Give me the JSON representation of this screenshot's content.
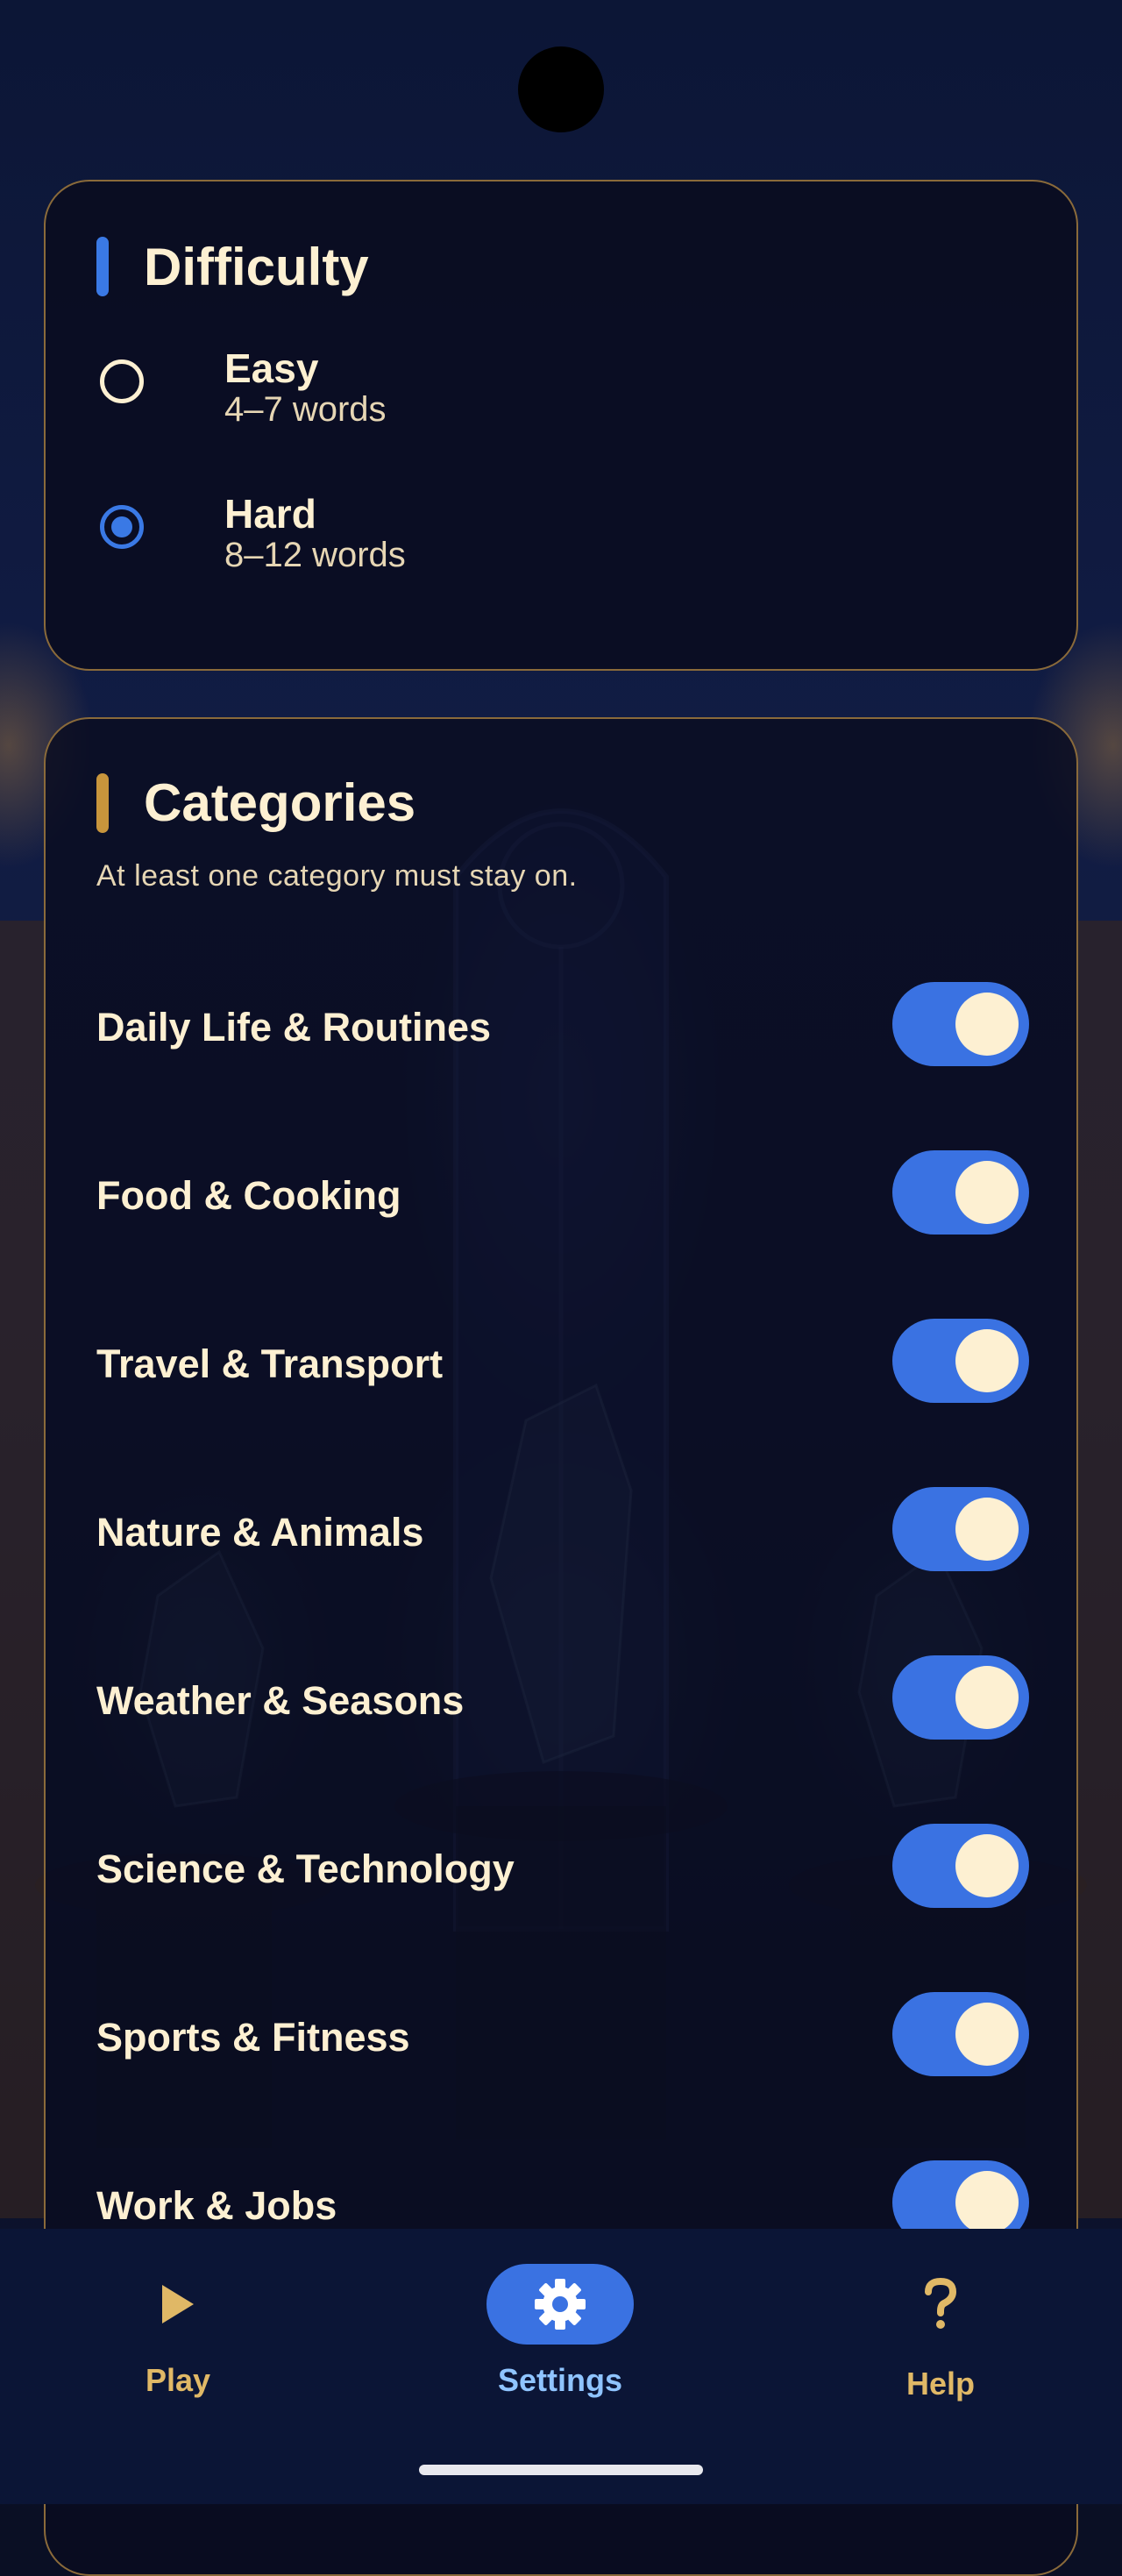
{
  "difficulty": {
    "title": "Difficulty",
    "accent_color": "#3a79e5",
    "options": [
      {
        "label": "Easy",
        "sublabel": "4–7 words",
        "selected": false
      },
      {
        "label": "Hard",
        "sublabel": "8–12 words",
        "selected": true
      }
    ]
  },
  "categories": {
    "title": "Categories",
    "accent_color": "#c8953c",
    "hint": "At least one category must stay on.",
    "items": [
      {
        "label": "Daily Life & Routines",
        "enabled": true
      },
      {
        "label": "Food & Cooking",
        "enabled": true
      },
      {
        "label": "Travel & Transport",
        "enabled": true
      },
      {
        "label": "Nature & Animals",
        "enabled": true
      },
      {
        "label": "Weather & Seasons",
        "enabled": true
      },
      {
        "label": "Science & Technology",
        "enabled": true
      },
      {
        "label": "Sports & Fitness",
        "enabled": true
      },
      {
        "label": "Work & Jobs",
        "enabled": true
      }
    ]
  },
  "nav": {
    "items": [
      {
        "label": "Play",
        "icon": "play-icon",
        "active": false
      },
      {
        "label": "Settings",
        "icon": "gear-icon",
        "active": true
      },
      {
        "label": "Help",
        "icon": "question-icon",
        "active": false
      }
    ],
    "active_color": "#3a72e2",
    "label_color": "#e0b866"
  }
}
